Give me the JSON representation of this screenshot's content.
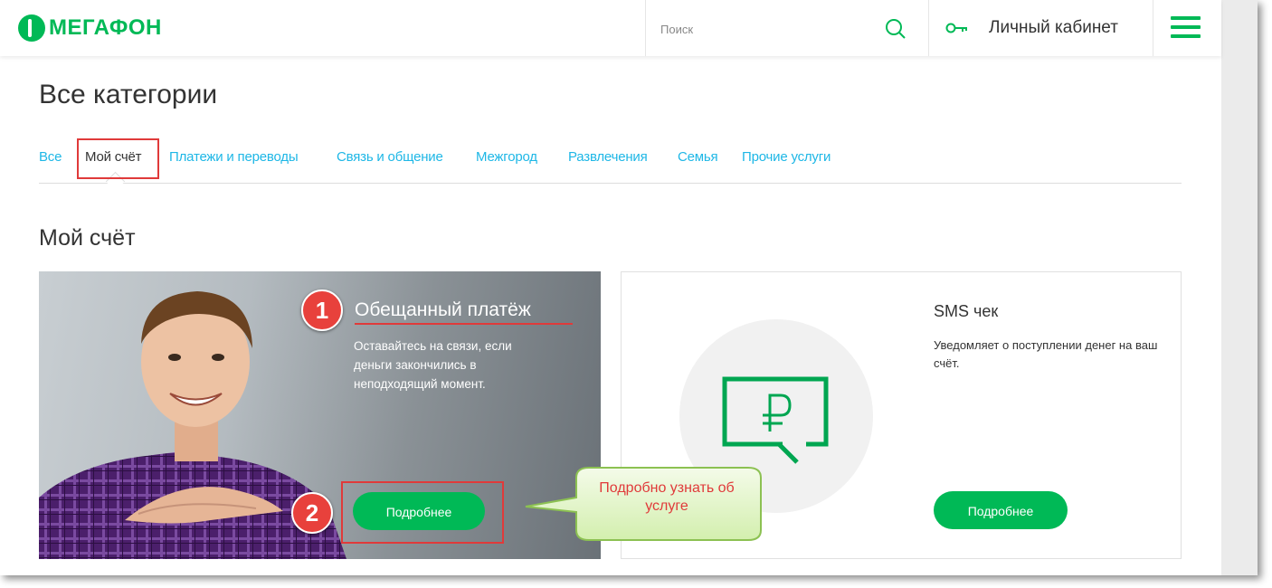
{
  "header": {
    "logo_text": "МегаФон",
    "search_placeholder": "Поиск",
    "account_label": "Личный кабинет"
  },
  "page": {
    "title": "Все категории",
    "tabs": [
      {
        "label": "Все"
      },
      {
        "label": "Мой счёт",
        "active": true
      },
      {
        "label": "Платежи и переводы"
      },
      {
        "label": "Связь и общение"
      },
      {
        "label": "Межгород"
      },
      {
        "label": "Развлечения"
      },
      {
        "label": "Семья"
      },
      {
        "label": "Прочие услуги"
      }
    ],
    "section_title": "Мой счёт"
  },
  "cards": [
    {
      "title": "Обещанный платёж",
      "description": "Оставайтесь на связи, если деньги закончились в неподходящий момент.",
      "button": "Подробнее"
    },
    {
      "title": "SMS чек",
      "description": "Уведомляет о поступлении денег на ваш счёт.",
      "button": "Подробнее",
      "icon": "ruble-message-icon"
    }
  ],
  "annotations": {
    "markers": [
      "1",
      "2"
    ],
    "callout": "Подробно узнать об услуге"
  },
  "colors": {
    "brand_green": "#00b956",
    "link_blue": "#1eb7e6",
    "highlight_red": "#e03a3a"
  }
}
